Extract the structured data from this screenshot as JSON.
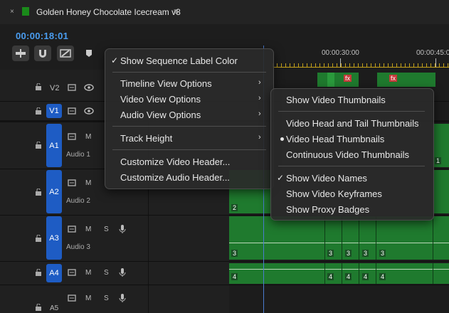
{
  "sequence": {
    "close_glyph": "×",
    "title": "Golden Honey Chocolate Icecream v8",
    "menu_glyph": "≡",
    "swatch_color": "#1a8a1a"
  },
  "playhead": {
    "timecode": "00:00:18:01"
  },
  "ruler": {
    "labels": [
      "00:00:30:00",
      "00:00:45:0"
    ]
  },
  "tracks": [
    {
      "id": "V2",
      "label": "V2",
      "targeted": false
    },
    {
      "id": "V1",
      "label": "V1",
      "targeted": true
    },
    {
      "id": "A1",
      "label": "A1",
      "name": "Audio 1",
      "controls": [
        "M"
      ]
    },
    {
      "id": "A2",
      "label": "A2",
      "name": "Audio 2",
      "controls": [
        "M"
      ]
    },
    {
      "id": "A3",
      "label": "A3",
      "name": "Audio 3",
      "controls": [
        "M",
        "S"
      ]
    },
    {
      "id": "A4",
      "label": "A4",
      "controls": [
        "M",
        "S"
      ]
    },
    {
      "id": "A5",
      "label": "A5",
      "controls": [
        "M",
        "S"
      ]
    }
  ],
  "clip_labels": {
    "a1": "1",
    "a2": "2",
    "a3": "3",
    "a4": "4",
    "fx": "fx"
  },
  "context_menu": {
    "items": [
      {
        "label": "Show Sequence Label Color",
        "checked": true
      },
      {
        "label": "Timeline View Options",
        "submenu": true
      },
      {
        "label": "Video View Options",
        "submenu": true
      },
      {
        "label": "Audio View Options",
        "submenu": true
      },
      {
        "label": "Track Height",
        "submenu": true
      },
      {
        "label": "Customize Video Header..."
      },
      {
        "label": "Customize Audio Header..."
      }
    ]
  },
  "submenu": {
    "items": [
      {
        "label": "Show Video Thumbnails"
      },
      {
        "label": "Video Head and Tail Thumbnails"
      },
      {
        "label": "Video Head Thumbnails",
        "selected": true
      },
      {
        "label": "Continuous Video Thumbnails"
      },
      {
        "label": "Show Video Names",
        "checked": true
      },
      {
        "label": "Show Video Keyframes"
      },
      {
        "label": "Show Proxy Badges"
      }
    ]
  },
  "glyphs": {
    "check": "✓",
    "arrow": "›"
  }
}
